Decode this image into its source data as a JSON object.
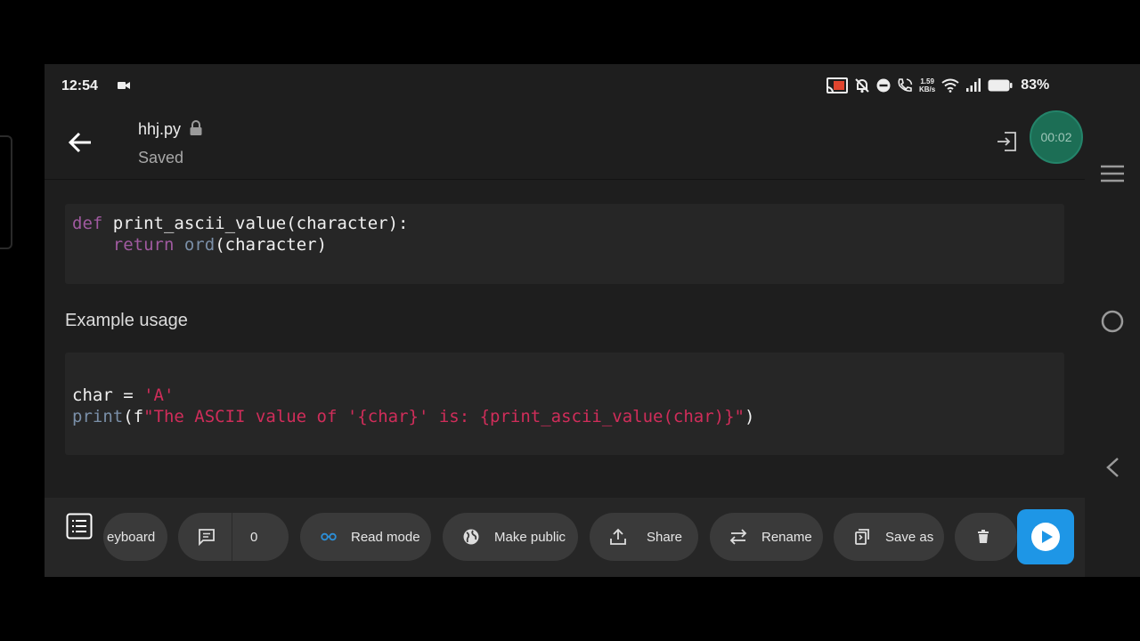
{
  "status_bar": {
    "time": "12:54",
    "speed_value": "1.59",
    "speed_unit": "KB/s",
    "battery": "83%"
  },
  "header": {
    "file_name": "hhj.py",
    "status": "Saved",
    "timer": "00:02"
  },
  "editor": {
    "code_block_1": {
      "line1": {
        "keyword": "def",
        "rest": " print_ascii_value(character):"
      },
      "line2": {
        "indent": "    ",
        "keyword": "return",
        "space": " ",
        "builtin": "ord",
        "rest": "(character)"
      }
    },
    "heading": "Example usage",
    "code_block_2": {
      "line1": {
        "plain": "char = ",
        "string": "'A'"
      },
      "line2": {
        "builtin": "print",
        "plain": "(f",
        "string": "\"The ASCII value of '{char}' is: {print_ascii_value(char)}\"",
        "close": ")"
      }
    }
  },
  "toolbar": {
    "keyboard_label": "eyboard",
    "comment_count": "0",
    "read_mode_label": "Read mode",
    "make_public_label": "Make public",
    "share_label": "Share",
    "rename_label": "Rename",
    "save_as_label": "Save as"
  },
  "icons": {
    "accent": "#1e96e6",
    "timer_bg": "#1c6e55",
    "string_color": "#d02d5a",
    "keyword_color": "#a05aa0"
  }
}
